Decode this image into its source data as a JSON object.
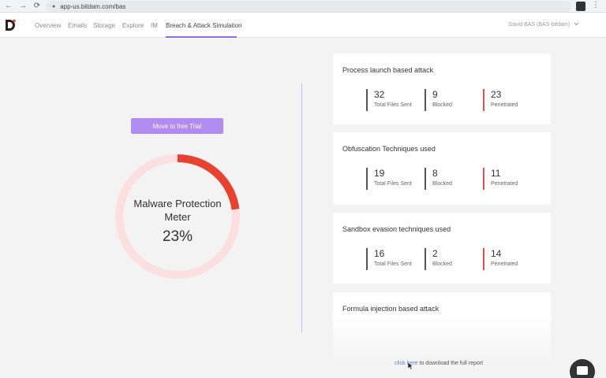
{
  "browser": {
    "url": "app-us.bitdam.com/bas",
    "back_glyph": "←",
    "forward_glyph": "→",
    "reload_glyph": "⟳",
    "menu_glyph": "⋮"
  },
  "header": {
    "tabs": [
      {
        "label": "Overview"
      },
      {
        "label": "Emails"
      },
      {
        "label": "Storage"
      },
      {
        "label": "Explore"
      },
      {
        "label": "IM"
      },
      {
        "label": "Breach & Attack Simulation",
        "active": true
      }
    ],
    "user": "David BAS (BAS-bitdam)"
  },
  "left": {
    "trial_button": "Move to free Trial",
    "meter": {
      "title_line1": "Malware Protection",
      "title_line2": "Meter",
      "value_text": "23%",
      "percent": 23,
      "color_fill": "#e8412f",
      "color_track": "#fbe0df"
    }
  },
  "cards": [
    {
      "title": "Process launch based attack",
      "stats": [
        {
          "value": "32",
          "label": "Total Files Sent"
        },
        {
          "value": "9",
          "label": "Blocked"
        },
        {
          "value": "23",
          "label": "Penetrated"
        }
      ]
    },
    {
      "title": "Obfuscation Techniques used",
      "stats": [
        {
          "value": "19",
          "label": "Total Files Sent"
        },
        {
          "value": "8",
          "label": "Blocked"
        },
        {
          "value": "11",
          "label": "Penetrated"
        }
      ]
    },
    {
      "title": "Sandbox evasion techniques used",
      "stats": [
        {
          "value": "16",
          "label": "Total Files Sent"
        },
        {
          "value": "2",
          "label": "Blocked"
        },
        {
          "value": "14",
          "label": "Penetrated"
        }
      ]
    },
    {
      "title": "Formula injection based attack"
    }
  ],
  "footer": {
    "link": "click here",
    "text": " to download the full report"
  },
  "colors": {
    "accent": "#8d6fe0",
    "button": "#b18cf0",
    "penetrated": "#e04e4e"
  }
}
